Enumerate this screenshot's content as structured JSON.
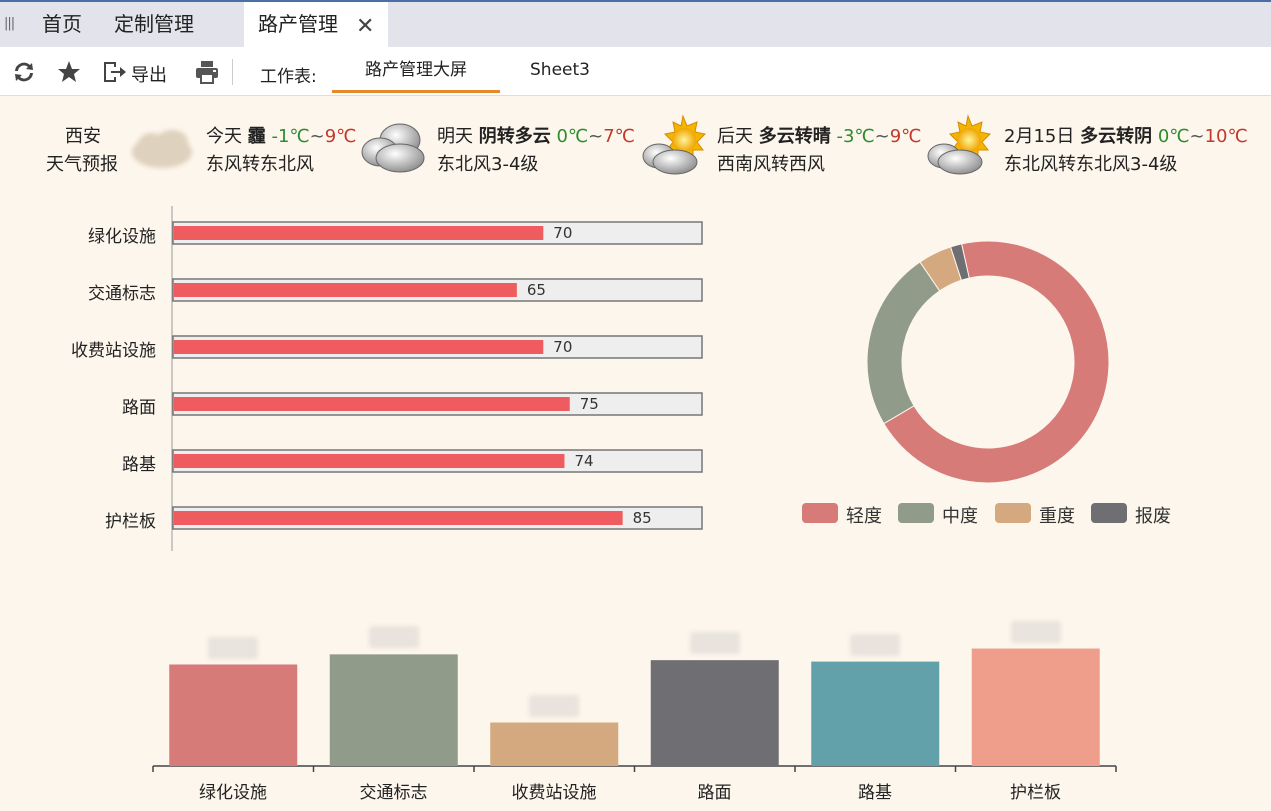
{
  "tabs": [
    {
      "label": "首页",
      "active": false
    },
    {
      "label": "定制管理",
      "active": false
    },
    {
      "label": "路产管理",
      "active": true
    }
  ],
  "close_glyph": "✕",
  "toolbar": {
    "export_label": "导出",
    "sheet_prefix": "工作表:",
    "sheets": [
      {
        "label": "路产管理大屏",
        "active": true
      },
      {
        "label": "Sheet3",
        "active": false
      }
    ]
  },
  "weather": {
    "city": "西安",
    "forecast_label": "天气预报",
    "days": [
      {
        "day": "今天",
        "cond": "霾",
        "low": "-1℃",
        "high": "9℃",
        "wind": "东风转东北风",
        "icon": "haze-icon"
      },
      {
        "day": "明天",
        "cond": "阴转多云",
        "low": "0℃",
        "high": "7℃",
        "wind": "东北风3-4级",
        "icon": "cloudy-icon"
      },
      {
        "day": "后天",
        "cond": "多云转晴",
        "low": "-3℃",
        "high": "9℃",
        "wind": "西南风转西风",
        "icon": "partly-sunny-icon"
      },
      {
        "day": "2月15日",
        "cond": "多云转阴",
        "low": "0℃",
        "high": "10℃",
        "wind": "东北风转东北风3-4级",
        "icon": "partly-sunny-icon"
      }
    ],
    "tilde": "~"
  },
  "chart_data": [
    {
      "type": "bar",
      "orientation": "horizontal",
      "categories": [
        "绿化设施",
        "交通标志",
        "收费站设施",
        "路面",
        "路基",
        "护栏板"
      ],
      "values": [
        70,
        65,
        70,
        75,
        74,
        85
      ],
      "xlim": [
        0,
        100
      ],
      "bar_color": "#ee5c5f",
      "track_color": "#eeeeee"
    },
    {
      "type": "pie",
      "style": "donut",
      "labels": [
        "轻度",
        "中度",
        "重度",
        "报废"
      ],
      "values": [
        70,
        24,
        4.5,
        1.5
      ],
      "colors": [
        "#d77b78",
        "#919b89",
        "#d4a97f",
        "#6e6e73"
      ],
      "legend": "bottom"
    },
    {
      "type": "bar",
      "orientation": "vertical",
      "categories": [
        "绿化设施",
        "交通标志",
        "收费站设施",
        "路面",
        "路基",
        "护栏板"
      ],
      "values": [
        70,
        77,
        30,
        73,
        72,
        81
      ],
      "colors": [
        "#d77b78",
        "#919b89",
        "#d4a97f",
        "#6e6e73",
        "#62a0aa",
        "#ef9e8c"
      ],
      "ylim": [
        0,
        100
      ]
    }
  ]
}
